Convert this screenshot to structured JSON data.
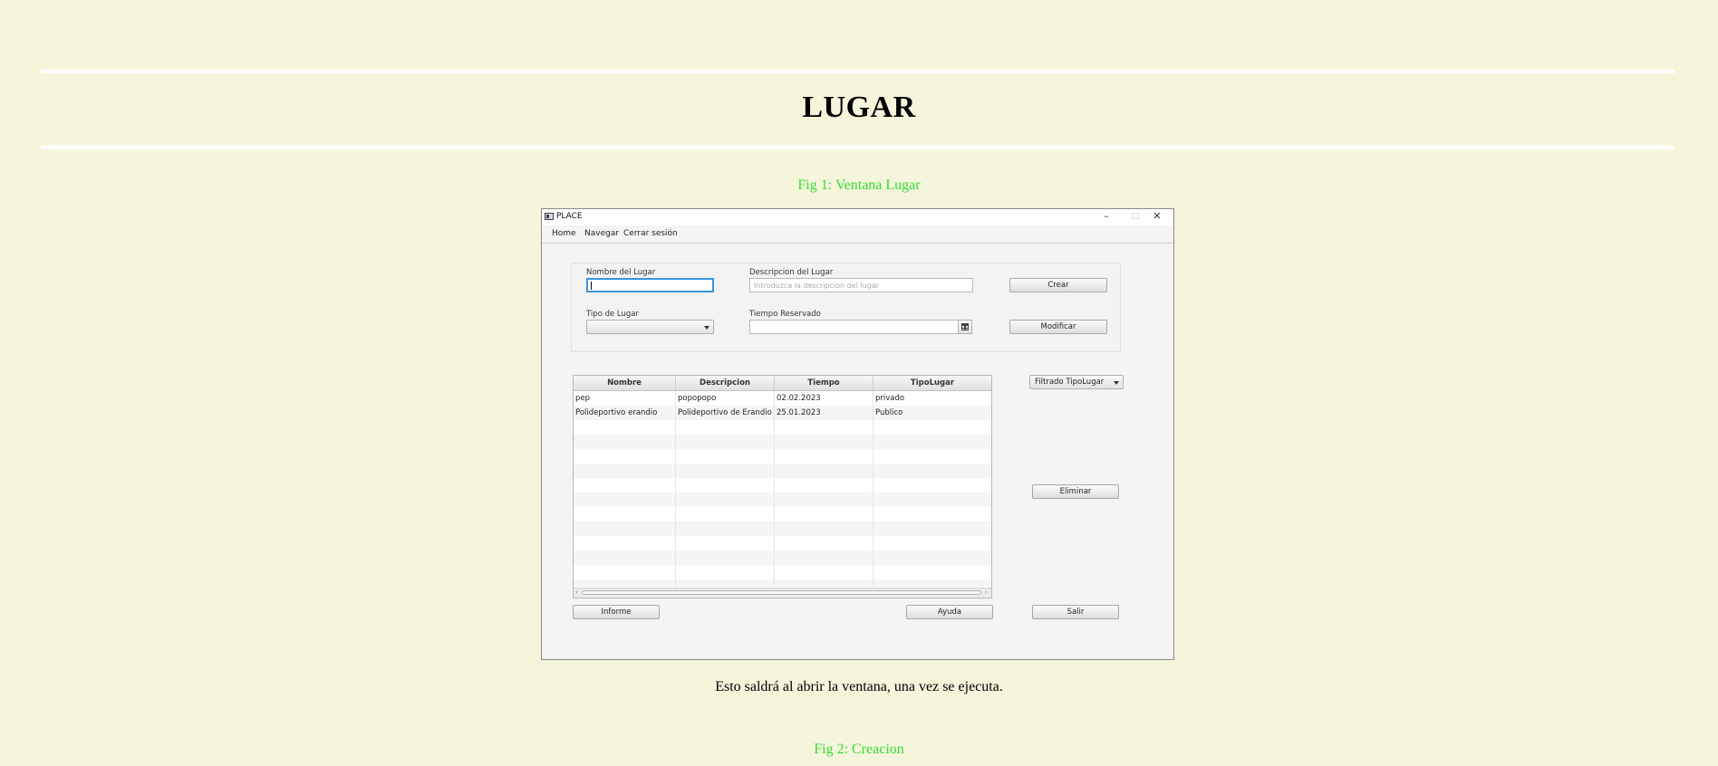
{
  "page": {
    "title": "LUGAR",
    "fig1_caption": "Fig 1: Ventana Lugar",
    "description": "Esto saldrá al abrir la ventana, una vez se ejecuta.",
    "fig2_caption": "Fig 2: Creacion"
  },
  "colors": {
    "background": "#f5f5dc",
    "caption": "#33dd33",
    "focus": "#3b95d9"
  },
  "window": {
    "title": "PLACE",
    "controls": {
      "minimize": "–",
      "maximize": "□",
      "close": "✕"
    }
  },
  "menu": {
    "items": [
      "Home",
      "Navegar",
      "Cerrar sesión"
    ]
  },
  "form": {
    "nombre_label": "Nombre del Lugar",
    "nombre_value": "",
    "descripcion_label": "Descripcion del Lugar",
    "descripcion_placeholder": "Introduzca la descripcion del lugar",
    "tipo_label": "Tipo de Lugar",
    "tipo_value": "",
    "tiempo_label": "Tiempo Reservado",
    "tiempo_value": "",
    "crear_button": "Crear",
    "modificar_button": "Modificar"
  },
  "table": {
    "columns": [
      "Nombre",
      "Descripcion",
      "Tiempo",
      "TipoLugar"
    ],
    "rows": [
      [
        "pep",
        "popopopo",
        "02.02.2023",
        "privado"
      ],
      [
        "Polideportivo erandio",
        "Polideportivo de Erandio",
        "25.01.2023",
        "Publico"
      ]
    ]
  },
  "side": {
    "filter_combo": "Filtrado TipoLugar",
    "eliminar_button": "Eliminar",
    "salir_button": "Salir"
  },
  "bottom": {
    "informe_button": "Informe",
    "ayuda_button": "Ayuda"
  },
  "icons": {
    "calendar": "calendar-icon",
    "dropdown": "chevron-down-icon",
    "app": "app-icon"
  }
}
